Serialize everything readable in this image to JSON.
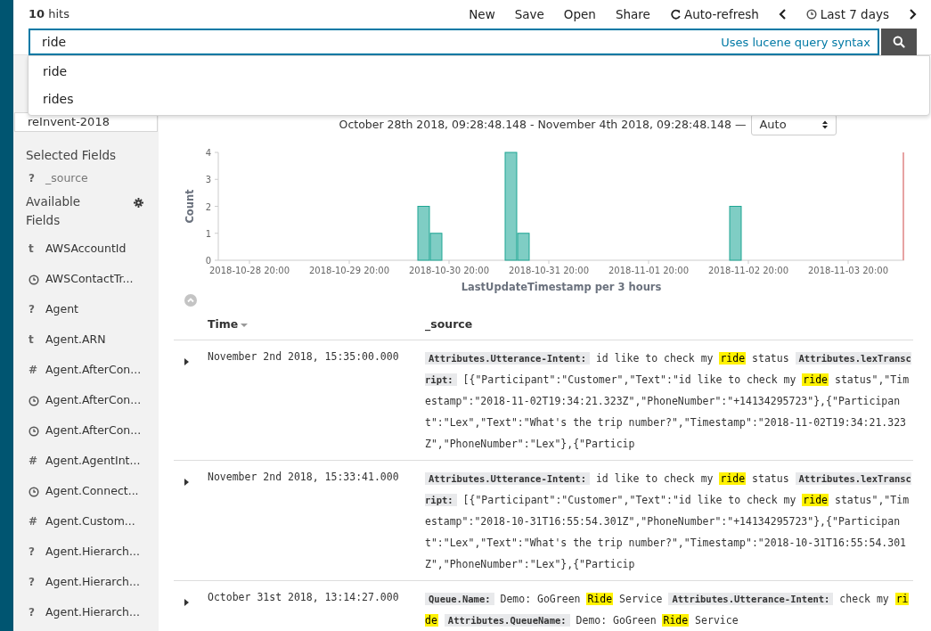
{
  "header": {
    "hits_count": "10",
    "hits_label": "hits",
    "menu": [
      {
        "kind": "plain",
        "label": "New"
      },
      {
        "kind": "plain",
        "label": "Save"
      },
      {
        "kind": "plain",
        "label": "Open"
      },
      {
        "kind": "plain",
        "label": "Share"
      },
      {
        "kind": "refresh",
        "label": "Auto-refresh"
      }
    ],
    "time_picker": {
      "label": "Last 7 days"
    }
  },
  "search": {
    "value": "ride",
    "hint": "Uses lucene query syntax"
  },
  "suggestions": [
    {
      "text": "ride"
    },
    {
      "text": "rides"
    }
  ],
  "sidebar": {
    "index_pattern": "reInvent-2018",
    "selected_title": "Selected Fields",
    "selected_fields": [
      {
        "kind": "glyph",
        "glyph": "?",
        "name": "_source"
      }
    ],
    "available_title": "Available Fields",
    "fields": [
      {
        "kind": "glyph",
        "glyph": "t",
        "name": "AWSAccountId"
      },
      {
        "kind": "date",
        "name": "AWSContactTr..."
      },
      {
        "kind": "glyph",
        "glyph": "?",
        "name": "Agent"
      },
      {
        "kind": "glyph",
        "glyph": "t",
        "name": "Agent.ARN"
      },
      {
        "kind": "glyph",
        "glyph": "#",
        "name": "Agent.AfterCon..."
      },
      {
        "kind": "date",
        "name": "Agent.AfterCon..."
      },
      {
        "kind": "date",
        "name": "Agent.AfterCon..."
      },
      {
        "kind": "glyph",
        "glyph": "#",
        "name": "Agent.AgentInt..."
      },
      {
        "kind": "date",
        "name": "Agent.Connect..."
      },
      {
        "kind": "glyph",
        "glyph": "#",
        "name": "Agent.Custom..."
      },
      {
        "kind": "glyph",
        "glyph": "?",
        "name": "Agent.Hierarch..."
      },
      {
        "kind": "glyph",
        "glyph": "?",
        "name": "Agent.Hierarch..."
      },
      {
        "kind": "glyph",
        "glyph": "?",
        "name": "Agent.Hierarch..."
      }
    ]
  },
  "time_range": {
    "text": "October 28th 2018, 09:28:48.148 - November 4th 2018, 09:28:48.148 —",
    "interval": "Auto"
  },
  "chart": {
    "chart_data": {
      "type": "bar",
      "xlabel": "LastUpdateTimestamp per 3 hours",
      "ylabel": "Count",
      "categories": [
        null,
        null,
        "2018-10-28 20:00",
        null,
        null,
        null,
        null,
        null,
        null,
        null,
        "2018-10-29 20:00",
        null,
        null,
        null,
        null,
        null,
        null,
        null,
        "2018-10-30 20:00",
        null,
        null,
        null,
        null,
        null,
        null,
        null,
        "2018-10-31 20:00",
        null,
        null,
        null,
        null,
        null,
        null,
        null,
        "2018-11-01 20:00",
        null,
        null,
        null,
        null,
        null,
        null,
        null,
        "2018-11-02 20:00",
        null,
        null,
        null,
        null,
        null,
        null,
        null,
        "2018-11-03 20:00",
        null,
        null,
        null,
        null
      ],
      "values": [
        0,
        0,
        0,
        0,
        0,
        0,
        0,
        0,
        0,
        0,
        0,
        0,
        0,
        0,
        0,
        0,
        2,
        1,
        0,
        0,
        0,
        0,
        0,
        4,
        1,
        0,
        0,
        0,
        0,
        0,
        0,
        0,
        0,
        0,
        0,
        0,
        0,
        0,
        0,
        0,
        0,
        2,
        0,
        0,
        0,
        0,
        0,
        0,
        0,
        0,
        0,
        0,
        0,
        0,
        0
      ],
      "ylim": [
        0,
        4
      ],
      "yticks": [
        0,
        1,
        2,
        3,
        4
      ]
    }
  },
  "table": {
    "columns": [
      {
        "label": "Time",
        "sortable": true
      },
      {
        "label": "_source",
        "sortable": false
      }
    ],
    "rows": [
      {
        "time": "November 2nd 2018, 15:35:00.000",
        "source": [
          {
            "kind": "key",
            "text": "Attributes.Utterance-Intent:"
          },
          {
            "kind": "text",
            "text": " id like to check my "
          },
          {
            "kind": "hit",
            "text": "ride"
          },
          {
            "kind": "text",
            "text": " status "
          },
          {
            "kind": "key",
            "text": "Attributes.lexTranscript:"
          },
          {
            "kind": "text",
            "text": " [{\"Participant\":\"Customer\",\"Text\":\"id like to check my "
          },
          {
            "kind": "hit",
            "text": "ride"
          },
          {
            "kind": "text",
            "text": " status\",\"Timestamp\":\"2018-11-02T19:34:21.323Z\",\"PhoneNumber\":\"+14134295723\"},{\"Participant\":\"Lex\",\"Text\":\"What's the trip number?\",\"Timestamp\":\"2018-11-02T19:34:21.323Z\",\"PhoneNumber\":\"Lex\"},{\"Particip"
          }
        ]
      },
      {
        "time": "November 2nd 2018, 15:33:41.000",
        "source": [
          {
            "kind": "key",
            "text": "Attributes.Utterance-Intent:"
          },
          {
            "kind": "text",
            "text": " id like to check my "
          },
          {
            "kind": "hit",
            "text": "ride"
          },
          {
            "kind": "text",
            "text": " status "
          },
          {
            "kind": "key",
            "text": "Attributes.lexTranscript:"
          },
          {
            "kind": "text",
            "text": " [{\"Participant\":\"Customer\",\"Text\":\"id like to check my "
          },
          {
            "kind": "hit",
            "text": "ride"
          },
          {
            "kind": "text",
            "text": " status\",\"Timestamp\":\"2018-10-31T16:55:54.301Z\",\"PhoneNumber\":\"+14134295723\"},{\"Participant\":\"Lex\",\"Text\":\"What's the trip number?\",\"Timestamp\":\"2018-10-31T16:55:54.301Z\",\"PhoneNumber\":\"Lex\"},{\"Particip"
          }
        ]
      },
      {
        "time": "October 31st 2018, 13:14:27.000",
        "source": [
          {
            "kind": "key",
            "text": "Queue.Name:"
          },
          {
            "kind": "text",
            "text": " Demo: GoGreen "
          },
          {
            "kind": "hit",
            "text": "Ride"
          },
          {
            "kind": "text",
            "text": " Service "
          },
          {
            "kind": "key",
            "text": "Attributes.Utterance-Intent:"
          },
          {
            "kind": "text",
            "text": " check my "
          },
          {
            "kind": "hit",
            "text": "ride"
          },
          {
            "kind": "key",
            "text": "Attributes.QueueName:"
          },
          {
            "kind": "text",
            "text": " Demo: GoGreen "
          },
          {
            "kind": "hit",
            "text": "Ride"
          },
          {
            "kind": "text",
            "text": " Service"
          }
        ]
      }
    ]
  }
}
